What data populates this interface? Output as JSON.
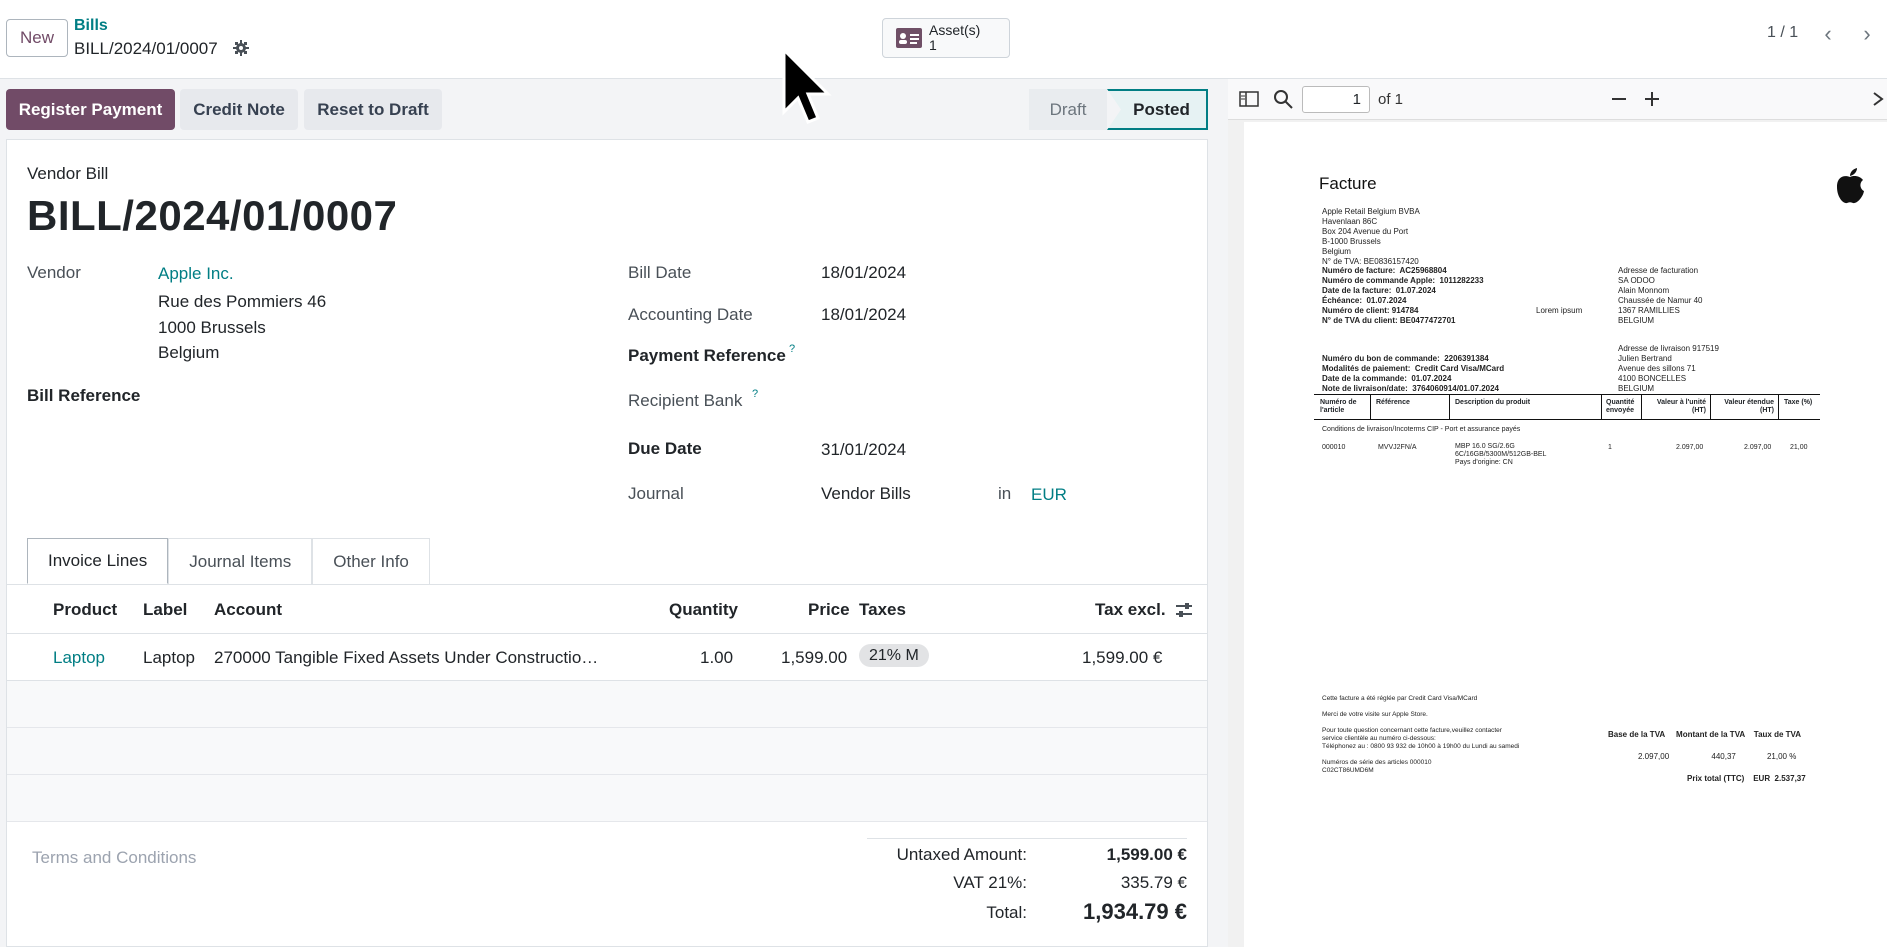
{
  "topbar": {
    "new_label": "New",
    "breadcrumb_parent": "Bills",
    "breadcrumb_current": "BILL/2024/01/0007",
    "asset_label": "Asset(s)",
    "asset_count": "1",
    "pager": "1 / 1"
  },
  "actions": {
    "register_payment": "Register Payment",
    "credit_note": "Credit Note",
    "reset_to_draft": "Reset to Draft"
  },
  "status": {
    "draft": "Draft",
    "posted": "Posted",
    "active": "Posted"
  },
  "form": {
    "type_label": "Vendor Bill",
    "name": "BILL/2024/01/0007",
    "vendor_label": "Vendor",
    "vendor_name": "Apple Inc.",
    "vendor_address": [
      "Rue des Pommiers 46",
      "1000 Brussels",
      "Belgium"
    ],
    "bill_reference_label": "Bill Reference",
    "bill_date_label": "Bill Date",
    "bill_date": "18/01/2024",
    "accounting_date_label": "Accounting Date",
    "accounting_date": "18/01/2024",
    "payment_reference_label": "Payment Reference",
    "recipient_bank_label": "Recipient Bank",
    "help_mark": "?",
    "due_date_label": "Due Date",
    "due_date": "31/01/2024",
    "journal_label": "Journal",
    "journal": "Vendor Bills",
    "in_label": "in",
    "currency": "EUR"
  },
  "tabs": [
    {
      "label": "Invoice Lines",
      "active": true
    },
    {
      "label": "Journal Items",
      "active": false
    },
    {
      "label": "Other Info",
      "active": false
    }
  ],
  "lines": {
    "headers": {
      "product": "Product",
      "label": "Label",
      "account": "Account",
      "quantity": "Quantity",
      "price": "Price",
      "taxes": "Taxes",
      "tax_excl": "Tax excl."
    },
    "rows": [
      {
        "product": "Laptop",
        "label": "Laptop",
        "account": "270000 Tangible Fixed Assets Under Constructio…",
        "quantity": "1.00",
        "price": "1,599.00",
        "taxes": "21% M",
        "tax_excl": "1,599.00 €"
      }
    ]
  },
  "terms_placeholder": "Terms and Conditions",
  "totals": {
    "untaxed_label": "Untaxed Amount:",
    "untaxed": "1,599.00 €",
    "vat_label": "VAT 21%:",
    "vat": "335.79 €",
    "total_label": "Total:",
    "total": "1,934.79 €"
  },
  "pdf": {
    "page_value": "1",
    "page_of": "of 1",
    "title": "Facture",
    "seller": "Apple Retail Belgium BVBA\nHavenlaan 86C\nBox 204 Avenue du Port\nB-1000 Brussels\nBelgium\nN° de TVA: BE0836157420",
    "invoice_info": "Numéro de facture:  AC25968804\nNuméro de commande Apple:  1011282233\nDate de la facture:  01.07.2024\nÉchéance:  01.07.2024\nNuméro de client: 914784\nN° de TVA du client: BE0477472701",
    "lorem": "Lorem ipsum",
    "billing": "Adresse de facturation\nSA ODOO\nAlain Monnom\nChaussée de Namur 40\n1367 RAMILLIES\nBELGIUM",
    "order_info": "Numéro du bon de commande:  2206391384\nModalités de paiement:  Credit Card Visa/MCard\nDate de la commande:  01.07.2024\nNote de livraison/date:  3764060914/01.07.2024",
    "delivery": "Adresse de livraison 917519\nJulien Bertrand\nAvenue des sillons 71\n4100 BONCELLES\nBELGIUM",
    "table_headers": [
      "Numéro de\nl'article",
      "Référence",
      "Description du produit",
      "Quantité\nenvoyée",
      "Valeur à l'unité\n(HT)",
      "Valeur étendue\n(HT)",
      "Taxe (%)"
    ],
    "conditions": "Conditions de livraison/Incoterms CIP - Port et assurance payés",
    "item": {
      "num": "000010",
      "ref": "MVVJ2FN/A",
      "desc": "MBP 16.0 SG/2.6G\n6C/16GB/5300M/512GB-BEL\nPays d'origine: CN",
      "qty": "1",
      "unit": "2.097,00",
      "ext": "2.097,00",
      "tax": "21,00"
    },
    "footer_left": "Cette facture a été réglée par Credit Card Visa/MCard\n\nMerci de votre visite sur Apple Store.\n\nPour toute question concernant cette facture,veuillez contacter\nservice clientèle au numéro ci-dessous:\nTéléphonez au : 0800 93 932 de 10h00 à 19h00 du Lundi au samedi\n\nNuméros de série des articles 000010\nC02CT86UMD6M",
    "vat_headers": "Base de la TVA     Montant de la TVA    Taux de TVA",
    "vat_values": "2.097,00                   440,37              21,00 %",
    "total_line": "Prix total (TTC)    EUR  2.537,37"
  }
}
